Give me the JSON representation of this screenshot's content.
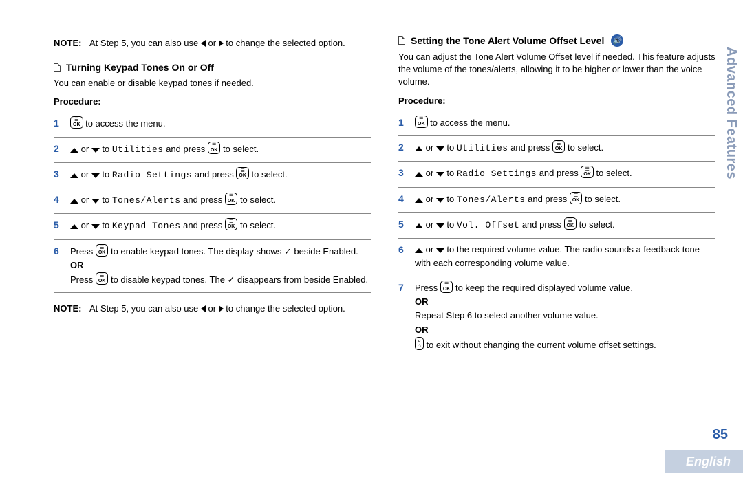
{
  "sideTab": "Advanced Features",
  "pageNumber": "85",
  "language": "English",
  "left": {
    "note1": {
      "label": "NOTE:",
      "body_a": "At Step 5, you can also use ",
      "body_b": " or ",
      "body_c": " to change the selected option."
    },
    "heading": "Turning Keypad Tones On or Off",
    "intro": "You can enable or disable keypad tones if needed.",
    "procLabel": "Procedure:",
    "s1": {
      "a": " to access the menu."
    },
    "s2": {
      "a": " or ",
      "b": " to ",
      "menu": "Utilities",
      "c": " and press ",
      "d": " to select."
    },
    "s3": {
      "a": " or ",
      "b": " to ",
      "menu": "Radio Settings",
      "c": " and press ",
      "d": " to select."
    },
    "s4": {
      "a": " or ",
      "b": " to ",
      "menu": "Tones/Alerts",
      "c": " and press ",
      "d": " to select."
    },
    "s5": {
      "a": " or ",
      "b": " to ",
      "menu": "Keypad Tones",
      "c": " and press ",
      "d": " to select."
    },
    "s6": {
      "a": "Press ",
      "b": " to enable keypad tones. The display shows ✓ beside Enabled.",
      "or": "OR",
      "c": "Press ",
      "d": " to disable keypad tones. The ✓ disappears from beside Enabled."
    },
    "note2": {
      "label": "NOTE:",
      "body_a": "At Step 5, you can also use ",
      "body_b": " or ",
      "body_c": " to change the selected option."
    }
  },
  "right": {
    "heading": "Setting the Tone Alert Volume Offset Level",
    "intro": "You can adjust the Tone Alert Volume Offset level if needed. This feature adjusts the volume of the tones/alerts, allowing it to be higher or lower than the voice volume.",
    "procLabel": "Procedure:",
    "s1": {
      "a": " to access the menu."
    },
    "s2": {
      "a": " or ",
      "b": " to ",
      "menu": "Utilities",
      "c": " and press ",
      "d": " to select."
    },
    "s3": {
      "a": " or ",
      "b": " to ",
      "menu": "Radio Settings",
      "c": " and press ",
      "d": " to select."
    },
    "s4": {
      "a": " or ",
      "b": " to ",
      "menu": "Tones/Alerts",
      "c": " and press ",
      "d": " to select."
    },
    "s5": {
      "a": " or ",
      "b": " to ",
      "menu": "Vol. Offset",
      "c": " and press ",
      "d": " to select."
    },
    "s6": {
      "a": " or ",
      "b": " to the required volume value. The radio sounds a feedback tone with each corresponding volume value."
    },
    "s7": {
      "a": "Press ",
      "b": " to keep the required displayed volume value.",
      "or1": "OR",
      "c": "Repeat Step 6 to select another volume value.",
      "or2": "OR",
      "d": " to exit without changing the current volume offset settings."
    }
  }
}
